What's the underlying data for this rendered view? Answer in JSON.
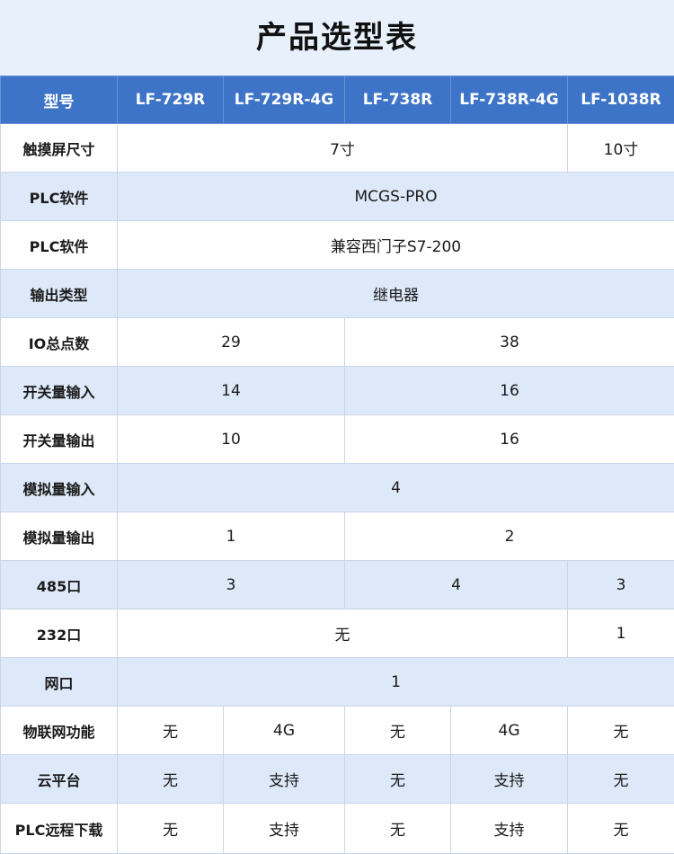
{
  "title": "产品选型表",
  "header": {
    "col0": "型号",
    "models": [
      "LF-729R",
      "LF-729R-4G",
      "LF-738R",
      "LF-738R-4G",
      "LF-1038R"
    ]
  },
  "rows": {
    "screen": {
      "label": "触摸屏尺寸",
      "v1": "7寸",
      "v2": "10寸"
    },
    "plc1": {
      "label": "PLC软件",
      "v1": "MCGS-PRO"
    },
    "plc2": {
      "label": "PLC软件",
      "v1": "兼容西门子S7-200"
    },
    "output": {
      "label": "输出类型",
      "v1": "继电器"
    },
    "io": {
      "label": "IO总点数",
      "v1": "29",
      "v2": "38"
    },
    "di": {
      "label": "开关量输入",
      "v1": "14",
      "v2": "16"
    },
    "do": {
      "label": "开关量输出",
      "v1": "10",
      "v2": "16"
    },
    "ai": {
      "label": "模拟量输入",
      "v1": "4"
    },
    "ao": {
      "label": "模拟量输出",
      "v1": "1",
      "v2": "2"
    },
    "rs485": {
      "label": "485口",
      "v1": "3",
      "v2": "4",
      "v3": "3"
    },
    "rs232": {
      "label": "232口",
      "v1": "无",
      "v2": "1"
    },
    "net": {
      "label": "网口",
      "v1": "1"
    },
    "iot": {
      "label": "物联网功能",
      "c": [
        "无",
        "4G",
        "无",
        "4G",
        "无"
      ]
    },
    "cloud": {
      "label": "云平台",
      "c": [
        "无",
        "支持",
        "无",
        "支持",
        "无"
      ]
    },
    "download": {
      "label": "PLC远程下载",
      "c": [
        "无",
        "支持",
        "无",
        "支持",
        "无"
      ]
    }
  }
}
